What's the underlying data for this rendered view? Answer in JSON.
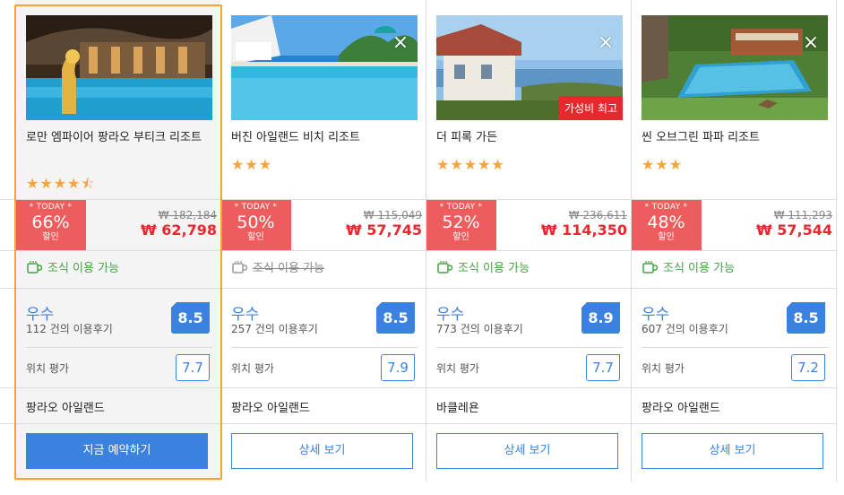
{
  "hotels": [
    {
      "name": "로만 엠파이어 팡라오 부티크 리조트",
      "stars": "★★★★⯪",
      "deal_today": "* TODAY *",
      "deal_pct": "66%",
      "deal_sub": "할인",
      "old_price": "₩ 182,184",
      "new_price": "₩ 62,798",
      "breakfast": "조식 이용 가능",
      "breakfast_available": true,
      "rating_word": "우수",
      "reviews": "112 건의 이용후기",
      "score": "8.5",
      "location_label": "위치 평가",
      "location_score": "7.7",
      "area": "팡라오 아일랜드",
      "button": "지금 예약하기",
      "badge": ""
    },
    {
      "name": "버진 아일랜드 비치 리조트",
      "stars": "★★★",
      "deal_today": "* TODAY *",
      "deal_pct": "50%",
      "deal_sub": "할인",
      "old_price": "₩ 115,049",
      "new_price": "₩ 57,745",
      "breakfast": "조식 이용 가능",
      "breakfast_available": false,
      "rating_word": "우수",
      "reviews": "257 건의 이용후기",
      "score": "8.5",
      "location_label": "위치 평가",
      "location_score": "7.9",
      "area": "팡라오 아일랜드",
      "button": "상세 보기",
      "badge": ""
    },
    {
      "name": "더 피록 가든",
      "stars": "★★★★★",
      "deal_today": "* TODAY *",
      "deal_pct": "52%",
      "deal_sub": "할인",
      "old_price": "₩ 236,611",
      "new_price": "₩ 114,350",
      "breakfast": "조식 이용 가능",
      "breakfast_available": true,
      "rating_word": "우수",
      "reviews": "773 건의 이용후기",
      "score": "8.9",
      "location_label": "위치 평가",
      "location_score": "7.7",
      "area": "바클레욘",
      "button": "상세 보기",
      "badge": "가성비 최고"
    },
    {
      "name": "씬 오브그린 파파 리조트",
      "stars": "★★★",
      "deal_today": "* TODAY *",
      "deal_pct": "48%",
      "deal_sub": "할인",
      "old_price": "₩ 111,293",
      "new_price": "₩ 57,544",
      "breakfast": "조식 이용 가능",
      "breakfast_available": true,
      "rating_word": "우수",
      "reviews": "607 건의 이용후기",
      "score": "8.5",
      "location_label": "위치 평가",
      "location_score": "7.2",
      "area": "팡라오 아일랜드",
      "button": "상세 보기",
      "badge": ""
    }
  ],
  "close_icon": "×",
  "colors": {
    "accent_blue": "#3b82e0",
    "deal_red": "#ee5d5d",
    "price_red": "#e8282d",
    "breakfast_green": "#46a244",
    "star_orange": "#f8a43a",
    "selected_border": "#f5a333"
  }
}
